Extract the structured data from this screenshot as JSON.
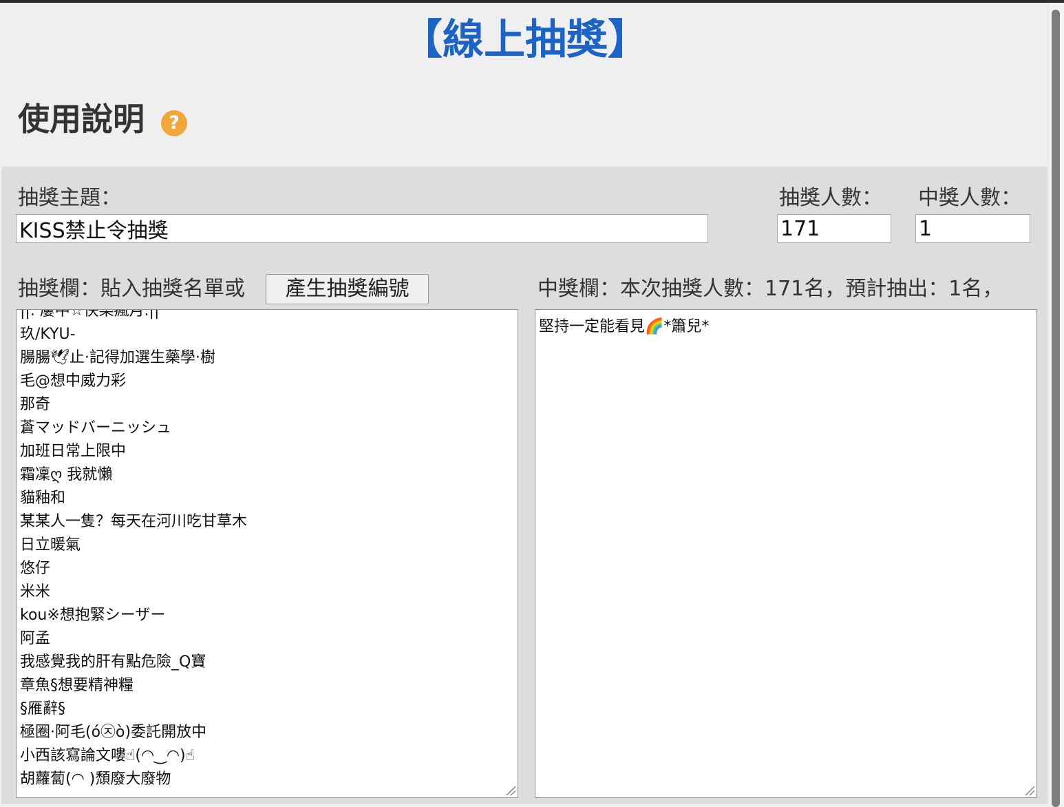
{
  "app": {
    "title": "【線上抽獎】"
  },
  "instructions": {
    "heading": "使用說明",
    "help_icon": "question-circle-icon",
    "help_glyph": "?"
  },
  "form": {
    "topic_label": "抽獎主題：",
    "topic_value": "KISS禁止令抽獎",
    "participants_label": "抽獎人數：",
    "participants_value": "171",
    "winners_count_label": "中獎人數：",
    "winners_count_value": "1"
  },
  "entries_panel": {
    "label": "抽獎欄：貼入抽獎名單或",
    "generate_button": "產生抽獎編號",
    "items": [
      "||. 屢中☆快樂瘋月.||",
      "玖/KYU-",
      "腸腸🕊止·記得加選生藥學·樹",
      "毛@想中威力彩",
      "那奇",
      "蒼マッドバーニッシュ",
      "加班日常上限中",
      "霜凜ღ 我就懶",
      "貓釉和",
      "某某人一隻？每天在河川吃甘草木",
      "日立暖氣",
      "悠仔",
      "米米",
      "kou※想抱緊シーザー",
      "阿孟",
      "我感覺我的肝有點危險_Q寶",
      "章魚§想要精神糧",
      "§雁辭§",
      "極圈·阿毛(ó㉨ò)委託開放中",
      "小西該寫論文嘍☝(◠‿◠)☝",
      "胡蘿蔔(◠ )頹廢大廢物"
    ]
  },
  "winners_panel": {
    "label": "中獎欄：本次抽獎人數：171名，預計抽出：1名，",
    "items": [
      "堅持一定能看見🌈*簫兒*"
    ]
  },
  "colors": {
    "title": "#1c63c8",
    "help_icon": "#f2a73a",
    "panel_bg": "#dddddd",
    "page_bg": "#efefef"
  }
}
